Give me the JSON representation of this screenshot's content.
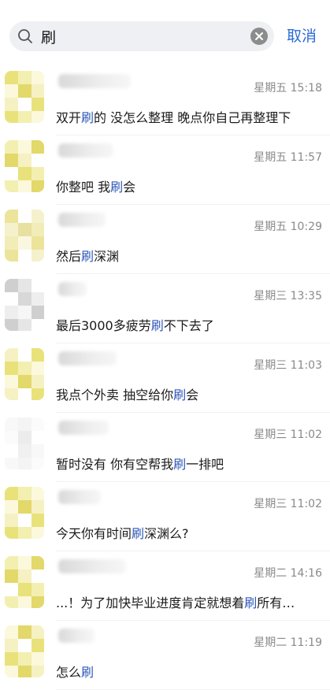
{
  "search": {
    "query": "刷",
    "cancel_label": "取消"
  },
  "results": [
    {
      "time": "星期五 15:18",
      "pre": "双开",
      "hit": "刷",
      "post": "的 没怎么整理  晚点你自己再整理下",
      "avatar": "yellow"
    },
    {
      "time": "星期五 11:57",
      "pre": "你整吧  我",
      "hit": "刷",
      "post": "会",
      "avatar": "yellow"
    },
    {
      "time": "星期五 10:29",
      "pre": "然后",
      "hit": "刷",
      "post": "深渊",
      "avatar": "yellow-light"
    },
    {
      "time": "星期三 13:35",
      "pre": "最后3000多疲劳",
      "hit": "刷",
      "post": "不下去了",
      "avatar": "grey"
    },
    {
      "time": "星期三 11:03",
      "pre": "我点个外卖  抽空给你",
      "hit": "刷",
      "post": "会",
      "avatar": "yellow"
    },
    {
      "time": "星期三 11:02",
      "pre": "暂时没有 你有空帮我",
      "hit": "刷",
      "post": "一排吧",
      "avatar": "pale"
    },
    {
      "time": "星期三 11:02",
      "pre": "今天你有时间",
      "hit": "刷",
      "post": "深渊么?",
      "avatar": "yellow"
    },
    {
      "time": "星期二 14:16",
      "pre": "...！为了加快毕业进度肯定就想着",
      "hit": "刷",
      "post": "所有…",
      "avatar": "yellow"
    },
    {
      "time": "星期二 11:19",
      "pre": "怎么",
      "hit": "刷",
      "post": "",
      "avatar": "yellow"
    }
  ],
  "colors": {
    "accent": "#2c6bd6",
    "highlight": "#2c55b8"
  }
}
